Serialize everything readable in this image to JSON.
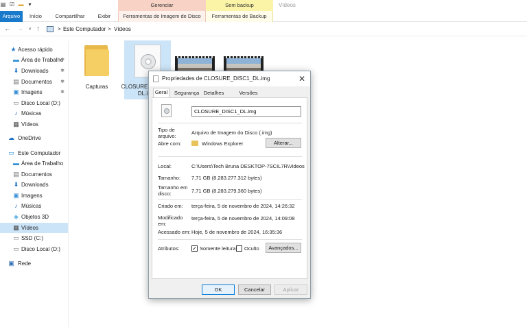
{
  "ribbon": {
    "context_gerenciar": "Gerenciar",
    "context_sem_backup": "Sem backup",
    "window_title": "Vídeos",
    "tabs": [
      "Arquivo",
      "Início",
      "Compartilhar",
      "Exibir",
      "Ferramentas de Imagem de Disco",
      "Ferramentas de Backup"
    ]
  },
  "address": {
    "crumb_pc": "Este Computador",
    "crumb_folder": "Vídeos",
    "separator": ">"
  },
  "sidebar": {
    "items": [
      {
        "label": "Acesso rápido",
        "icon": "star-icon"
      },
      {
        "label": "Área de Trabalho",
        "icon": "desktop-icon",
        "pinned": true
      },
      {
        "label": "Downloads",
        "icon": "download-icon",
        "pinned": true
      },
      {
        "label": "Documentos",
        "icon": "documents-icon",
        "pinned": true
      },
      {
        "label": "Imagens",
        "icon": "pictures-icon",
        "pinned": true
      },
      {
        "label": "Disco Local (D:)",
        "icon": "drive-icon"
      },
      {
        "label": "Músicas",
        "icon": "music-icon"
      },
      {
        "label": "Vídeos",
        "icon": "videos-icon"
      },
      {
        "label": "OneDrive",
        "icon": "cloud-icon"
      },
      {
        "label": "Este Computador",
        "icon": "computer-icon"
      },
      {
        "label": "Área de Trabalho",
        "icon": "desktop-icon"
      },
      {
        "label": "Documentos",
        "icon": "documents-icon"
      },
      {
        "label": "Downloads",
        "icon": "download-icon"
      },
      {
        "label": "Imagens",
        "icon": "pictures-icon"
      },
      {
        "label": "Músicas",
        "icon": "music-icon"
      },
      {
        "label": "Objetos 3D",
        "icon": "cube-icon"
      },
      {
        "label": "Vídeos",
        "icon": "videos-icon",
        "selected": true
      },
      {
        "label": "SSD (C:)",
        "icon": "drive-icon"
      },
      {
        "label": "Disco Local (D:)",
        "icon": "drive-icon"
      },
      {
        "label": "Rede",
        "icon": "network-icon"
      }
    ]
  },
  "files": {
    "folder_label": "Capturas",
    "image_label_line1": "CLOSURE",
    "image_label_line2": "DL.i"
  },
  "dialog": {
    "title": "Propriedades de CLOSURE_DISC1_DL.img",
    "tabs": [
      "Geral",
      "Segurança",
      "Detalhes",
      "Versões Anteriores"
    ],
    "file_name": "CLOSURE_DISC1_DL.img",
    "type_label": "Tipo de arquivo:",
    "type_value": "Arquivo de Imagem do Disco (.img)",
    "opens_label": "Abre com:",
    "opens_value": "Windows Explorer",
    "change_button": "Alterar...",
    "location_label": "Local:",
    "location_value": "C:\\Users\\Tech Bruna DESKTOP-7SCIL7R\\Videos",
    "size_label": "Tamanho:",
    "size_value": "7,71 GB (8.283.277.312 bytes)",
    "size_disk_label": "Tamanho em disco:",
    "size_disk_value": "7,71 GB (8.283.279.360 bytes)",
    "created_label": "Criado em:",
    "created_value": "terça-feira, 5 de novembro de 2024, 14:26:32",
    "modified_label": "Modificado em:",
    "modified_value": "terça-feira, 5 de novembro de 2024, 14:09:08",
    "accessed_label": "Acessado em:",
    "accessed_value": "Hoje, 5 de novembro de 2024, 16:35:36",
    "attributes_label": "Atributos:",
    "readonly_label": "Somente leitura",
    "readonly_checked": true,
    "hidden_label": "Oculto",
    "hidden_checked": false,
    "advanced_button": "Avançados...",
    "ok_button": "OK",
    "cancel_button": "Cancelar",
    "apply_button": "Aplicar"
  }
}
